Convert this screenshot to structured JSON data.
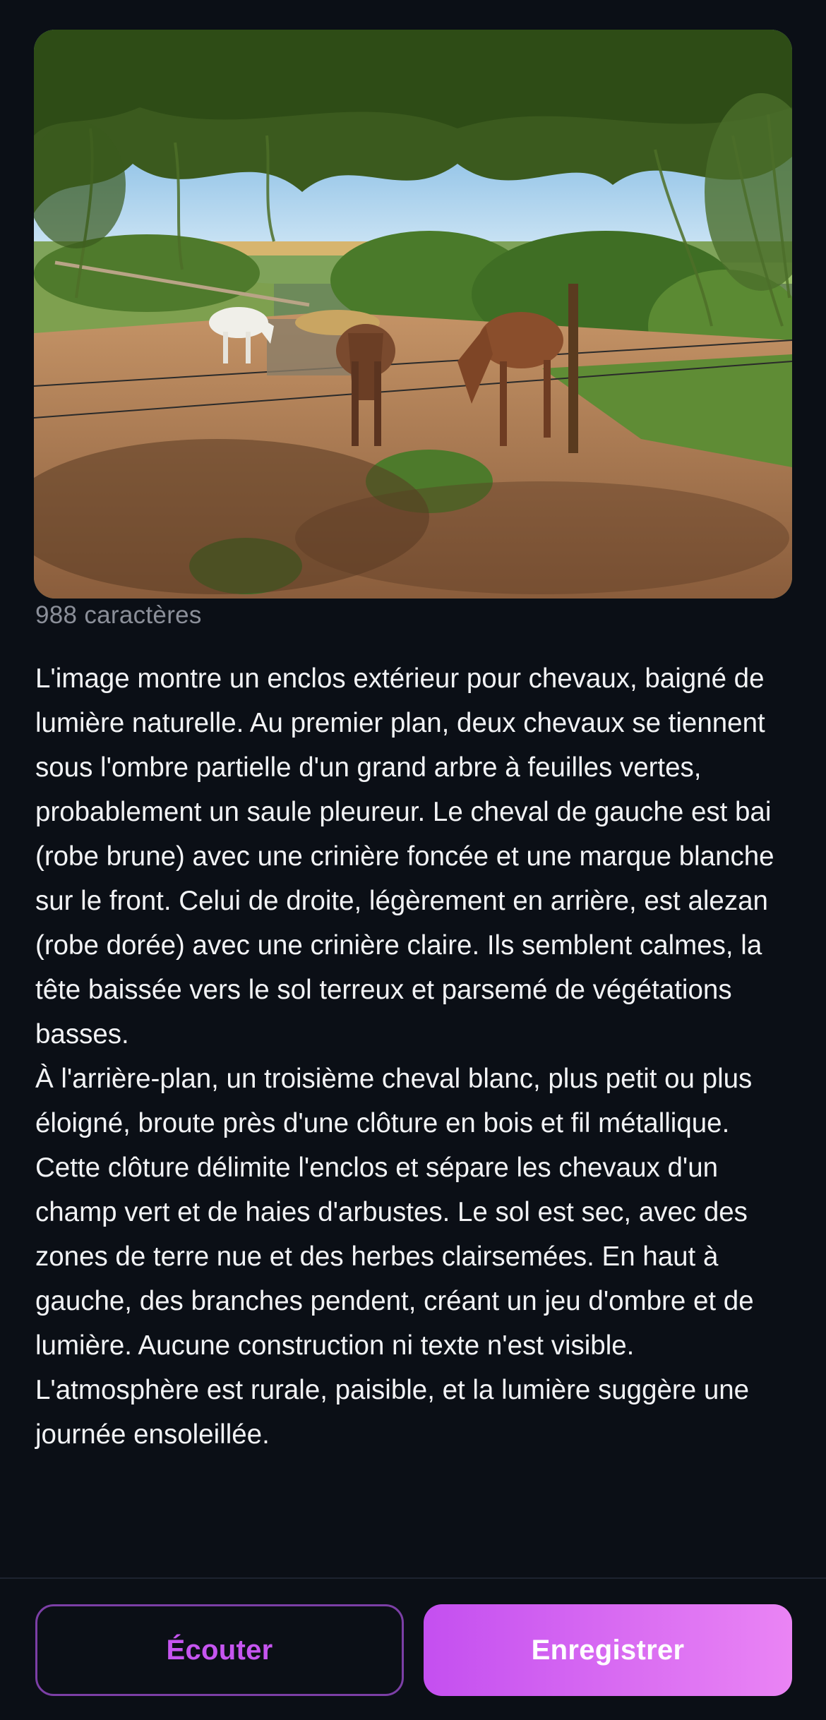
{
  "photo": {
    "description": "Horse paddock under a weeping willow"
  },
  "caption": {
    "char_count": "988 caractères"
  },
  "description": {
    "paragraphs": [
      "L'image montre un enclos extérieur pour chevaux, baigné de lumière naturelle. Au premier plan, deux chevaux se tiennent sous l'ombre partielle d'un grand arbre à feuilles vertes, probablement un saule pleureur. Le cheval de gauche est bai (robe brune) avec une crinière foncée et une marque blanche sur le front. Celui de droite, légèrement en arrière, est alezan (robe dorée) avec une crinière claire. Ils semblent calmes, la tête baissée vers le sol terreux et parsemé de végétations basses.",
      "À l'arrière-plan, un troisième cheval blanc, plus petit ou plus éloigné, broute près d'une clôture en bois et fil métallique. Cette clôture délimite l'enclos et sépare les chevaux d'un champ vert et de haies d'arbustes. Le sol est sec, avec des zones de terre nue et des herbes clairsemées. En haut à gauche, des branches pendent, créant un jeu d'ombre et de lumière. Aucune construction ni texte n'est visible. L'atmosphère est rurale, paisible, et la lumière suggère une journée ensoleillée."
    ]
  },
  "actions": {
    "listen_label": "Écouter",
    "save_label": "Enregistrer"
  },
  "colors": {
    "background": "#0b0f16",
    "accent": "#c655f0",
    "accent_gradient_end": "#ea84f4",
    "muted_text": "#8b8f99"
  }
}
